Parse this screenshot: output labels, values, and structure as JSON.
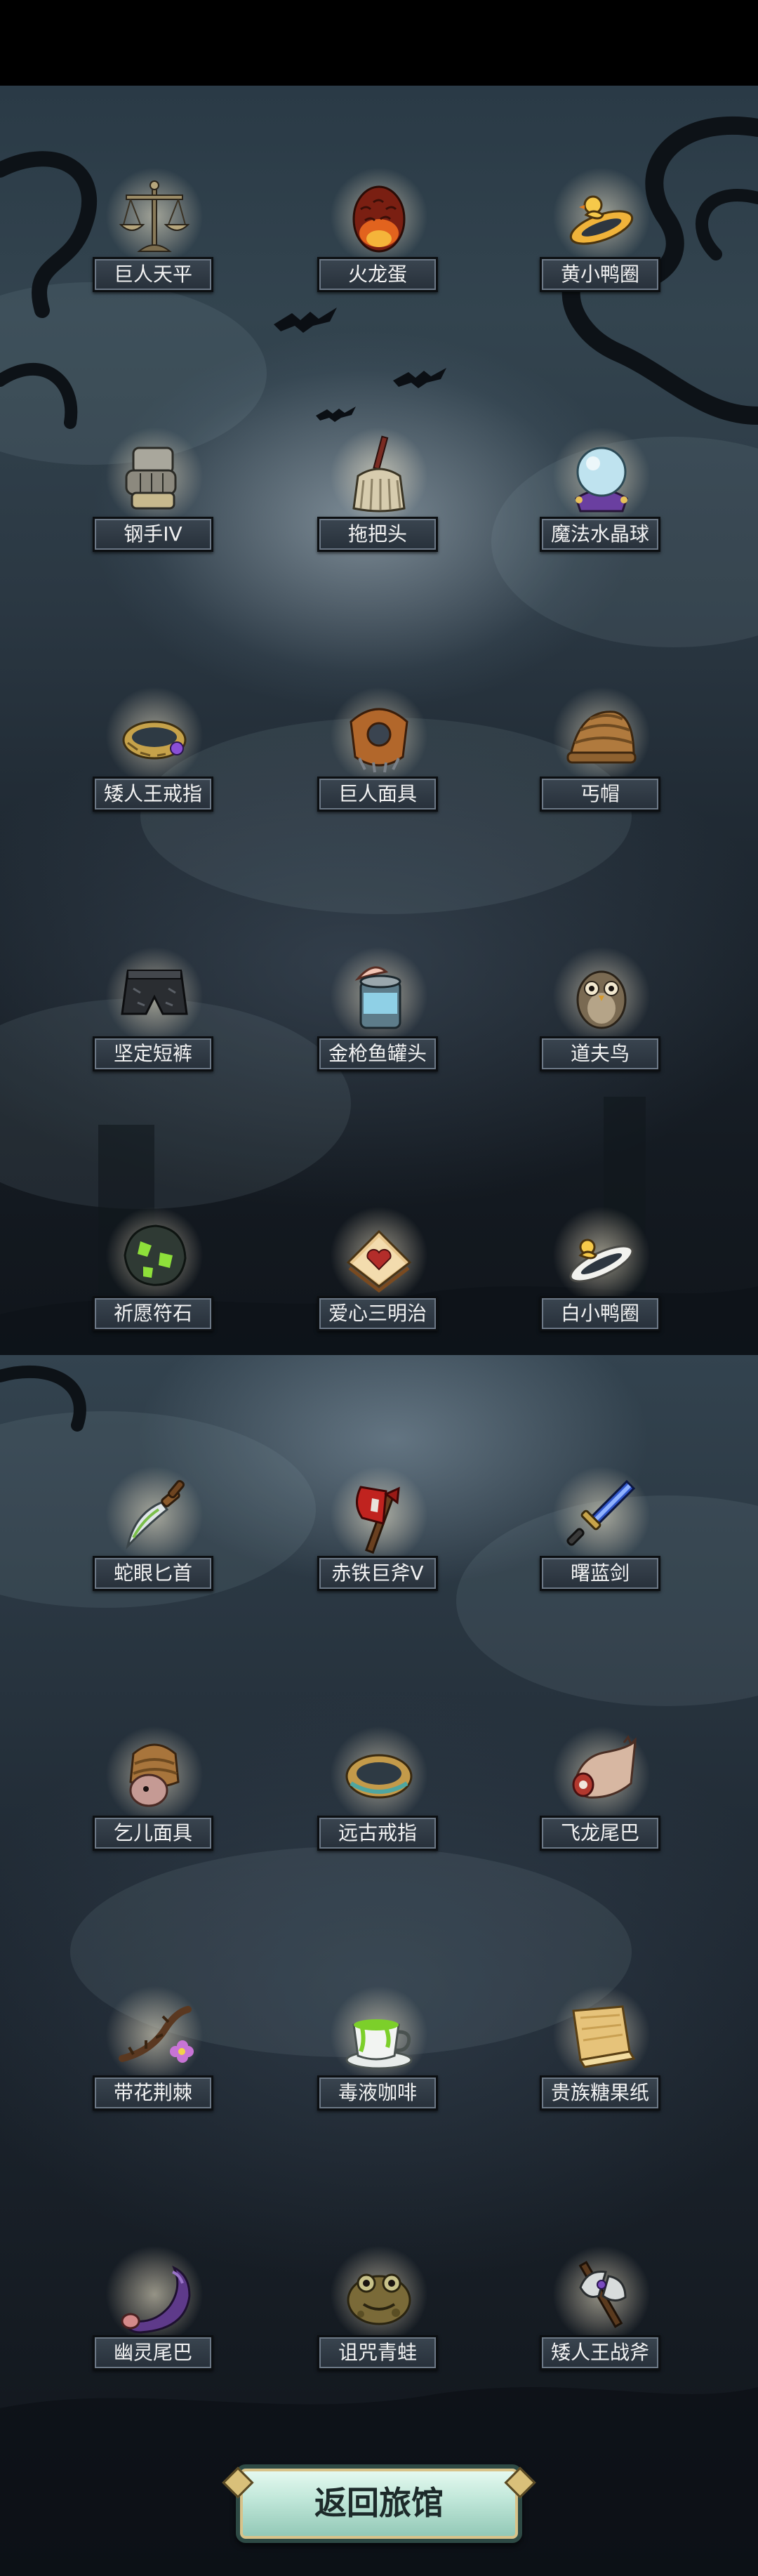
{
  "items": [
    {
      "label": "巨人天平",
      "icon": "scale-icon"
    },
    {
      "label": "火龙蛋",
      "icon": "dragon-egg-icon"
    },
    {
      "label": "黄小鸭圈",
      "icon": "yellow-duck-ring-icon"
    },
    {
      "label": "钢手IV",
      "icon": "steel-gauntlet-icon"
    },
    {
      "label": "拖把头",
      "icon": "mop-head-icon"
    },
    {
      "label": "魔法水晶球",
      "icon": "crystal-ball-icon"
    },
    {
      "label": "矮人王戒指",
      "icon": "dwarf-ring-icon"
    },
    {
      "label": "巨人面具",
      "icon": "giant-mask-icon"
    },
    {
      "label": "丐帽",
      "icon": "beggar-hat-icon"
    },
    {
      "label": "坚定短裤",
      "icon": "shorts-icon"
    },
    {
      "label": "金枪鱼罐头",
      "icon": "tuna-can-icon"
    },
    {
      "label": "道夫鸟",
      "icon": "owl-icon"
    },
    {
      "label": "祈愿符石",
      "icon": "rune-stone-icon"
    },
    {
      "label": "爱心三明治",
      "icon": "heart-sandwich-icon"
    },
    {
      "label": "白小鸭圈",
      "icon": "white-duck-ring-icon"
    },
    {
      "label": "蛇眼匕首",
      "icon": "dagger-icon"
    },
    {
      "label": "赤铁巨斧V",
      "icon": "red-axe-icon"
    },
    {
      "label": "曙蓝剑",
      "icon": "blue-sword-icon"
    },
    {
      "label": "乞儿面具",
      "icon": "beggar-mask-icon"
    },
    {
      "label": "远古戒指",
      "icon": "ancient-ring-icon"
    },
    {
      "label": "飞龙尾巴",
      "icon": "dragon-tail-icon"
    },
    {
      "label": "带花荆棘",
      "icon": "flower-thorn-icon"
    },
    {
      "label": "毒液咖啡",
      "icon": "poison-coffee-icon"
    },
    {
      "label": "贵族糖果纸",
      "icon": "candy-wrapper-icon"
    },
    {
      "label": "幽灵尾巴",
      "icon": "ghost-tail-icon"
    },
    {
      "label": "诅咒青蛙",
      "icon": "cursed-frog-icon"
    },
    {
      "label": "矮人王战斧",
      "icon": "battle-axe-icon"
    }
  ],
  "return_button": {
    "label": "返回旅馆"
  }
}
